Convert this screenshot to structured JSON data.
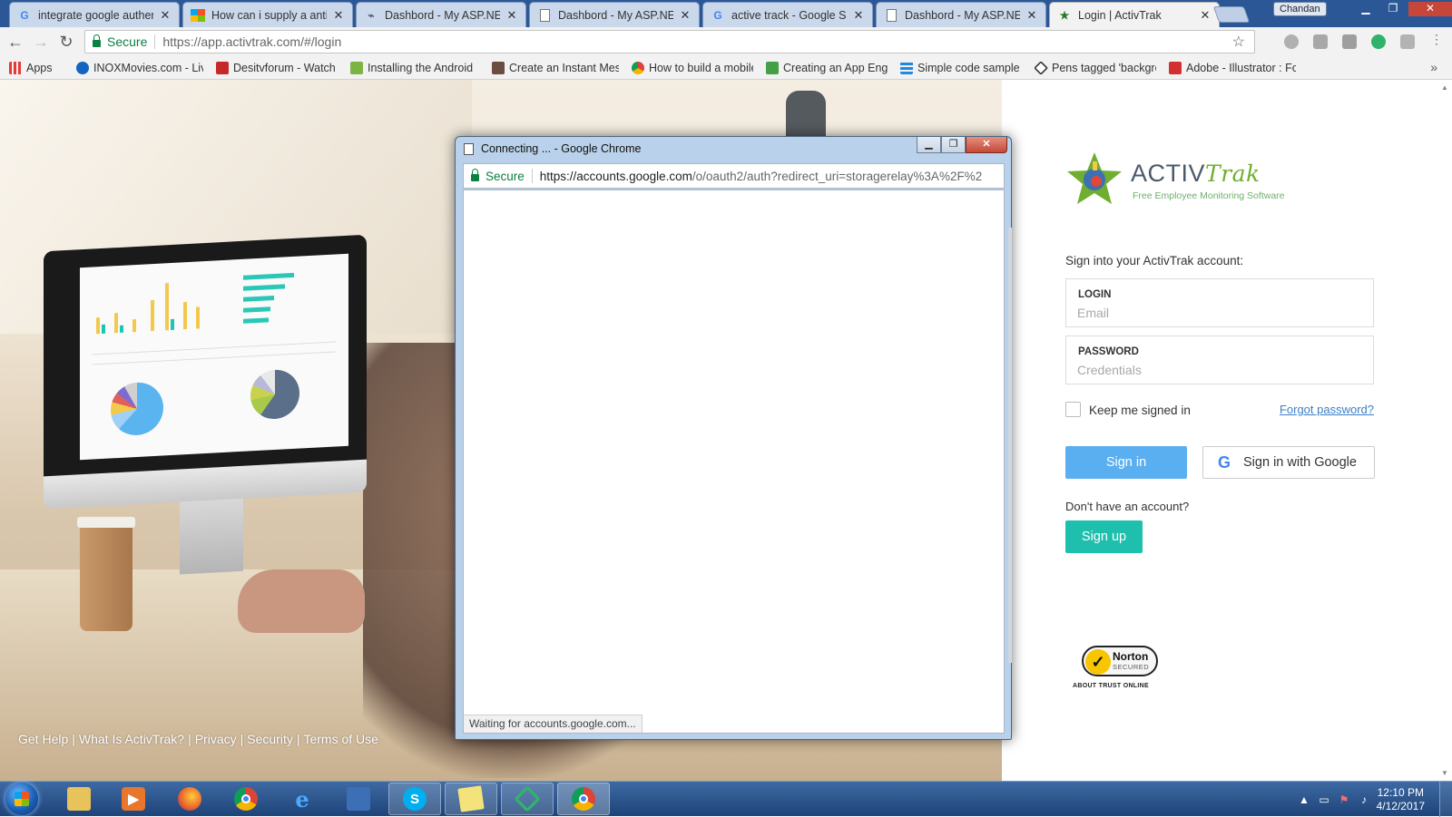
{
  "browser": {
    "tabs": [
      {
        "title": "integrate google authent",
        "icon": "google-g-icon"
      },
      {
        "title": "How can i supply a antifo",
        "icon": "microsoft-icon"
      },
      {
        "title": "Dashbord - My ASP.NET",
        "icon": "aspnet-icon"
      },
      {
        "title": "Dashbord - My ASP.NET",
        "icon": "page-icon"
      },
      {
        "title": "active track - Google Sea",
        "icon": "google-g-icon"
      },
      {
        "title": "Dashbord - My ASP.NET",
        "icon": "page-icon"
      },
      {
        "title": "Login | ActivTrak",
        "icon": "activtrak-icon",
        "active": true
      }
    ],
    "user_badge": "Chandan",
    "secure_label": "Secure",
    "url": "https://app.activtrak.com/#/login",
    "bookmarks": [
      {
        "label": "Apps",
        "icon": "apps-grid-icon",
        "color": "#e53935"
      },
      {
        "label": "INOXMovies.com - Liv",
        "icon": "inox-icon",
        "color": "#1565c0"
      },
      {
        "label": "Desitvforum - Watch",
        "icon": "desitv-icon",
        "color": "#c62828"
      },
      {
        "label": "Installing the Android",
        "icon": "android-icon",
        "color": "#7cb342"
      },
      {
        "label": "Create an Instant Mes",
        "icon": "bookmark-page-icon",
        "color": "#6d4c41"
      },
      {
        "label": "How to build a mobile",
        "icon": "chrome-bookmark-icon",
        "color": "#fbc02d"
      },
      {
        "label": "Creating an App Engi",
        "icon": "appengine-icon",
        "color": "#43a047"
      },
      {
        "label": "Simple code sample f",
        "icon": "grid-bookmark-icon",
        "color": "#1e88e5"
      },
      {
        "label": "Pens tagged 'backgro",
        "icon": "codepen-icon",
        "color": "#333333"
      },
      {
        "label": "Adobe - Illustrator : Fc",
        "icon": "adobe-icon",
        "color": "#d32f2f"
      }
    ]
  },
  "page": {
    "footer_links": [
      "Get Help",
      "What Is ActivTrak?",
      "Privacy",
      "Security",
      "Terms of Use"
    ],
    "logo": {
      "activ": "ACTIV",
      "trak": "Trak",
      "tagline": "Free Employee  Monitoring Software"
    },
    "signin_heading": "Sign into your ActivTrak account:",
    "login_label": "LOGIN",
    "login_placeholder": "Email",
    "password_label": "PASSWORD",
    "password_placeholder": "Credentials",
    "keep_signed_in": "Keep me signed in",
    "forgot_password": "Forgot password?",
    "signin_button": "Sign in",
    "google_button": "Sign in with Google",
    "no_account": "Don't have an account?",
    "signup_button": "Sign up",
    "norton": {
      "name": "Norton",
      "secured": "SECURED",
      "trust": "ABOUT TRUST ONLINE"
    }
  },
  "popup": {
    "title": "Connecting ... - Google Chrome",
    "secure_label": "Secure",
    "url_host": "https://accounts.google.com",
    "url_rest": "/o/oauth2/auth?redirect_uri=storagerelay%3A%2F%2",
    "status": "Waiting for accounts.google.com..."
  },
  "taskbar": {
    "apps": [
      {
        "name": "explorer",
        "glyph": "",
        "color": "#e8c25a"
      },
      {
        "name": "media-player",
        "glyph": "▶",
        "color": "#e8762b"
      },
      {
        "name": "firefox",
        "glyph": "",
        "color": "#e8602c"
      },
      {
        "name": "chrome",
        "glyph": "",
        "color": "#db4437"
      },
      {
        "name": "internet-explorer",
        "glyph": "e",
        "color": "#2a8ad8"
      },
      {
        "name": "remote-desktop",
        "glyph": "",
        "color": "#3d6fb6"
      },
      {
        "name": "skype",
        "glyph": "S",
        "color": "#00aff0"
      },
      {
        "name": "sticky-notes",
        "glyph": "",
        "color": "#f4e37a"
      },
      {
        "name": "visual-studio",
        "glyph": "",
        "color": "#2fb56a"
      },
      {
        "name": "chrome-active",
        "glyph": "",
        "color": "#db4437",
        "active": true
      }
    ],
    "time": "12:10 PM",
    "date": "4/12/2017"
  }
}
